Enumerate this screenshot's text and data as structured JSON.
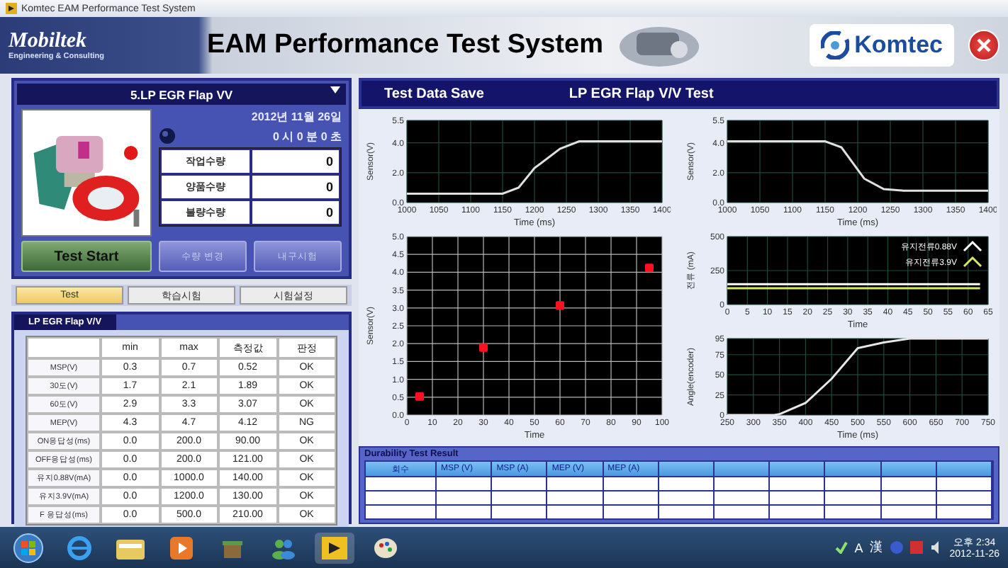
{
  "window": {
    "title": "Komtec EAM Performance Test System"
  },
  "header": {
    "logo": "Mobiltek",
    "logo_tagline": "Engineering & Consulting",
    "title": "EAM Performance Test System",
    "brand": "Komtec"
  },
  "model_select": {
    "value": "5.LP EGR Flap VV"
  },
  "date": "2012년 11월 26일",
  "time": "0 시 0 분 0 초",
  "counts": [
    {
      "label": "작업수량",
      "value": "0"
    },
    {
      "label": "양품수량",
      "value": "0"
    },
    {
      "label": "불량수량",
      "value": "0"
    }
  ],
  "buttons": [
    {
      "label": "Test Start",
      "kind": "start",
      "disabled": false
    },
    {
      "label": "수량 변경",
      "kind": "minor",
      "disabled": true
    },
    {
      "label": "내구시험",
      "kind": "minor",
      "disabled": true
    }
  ],
  "tabs": [
    {
      "label": "Test",
      "selected": true
    },
    {
      "label": "학습시험",
      "selected": false
    },
    {
      "label": "시험설정",
      "selected": false
    }
  ],
  "spec_table": {
    "title": "LP EGR Flap V/V",
    "columns": [
      "min",
      "max",
      "측정값",
      "판정"
    ],
    "rows": [
      {
        "name": "MSP(V)",
        "cells": [
          "0.3",
          "0.7",
          "0.52",
          "OK"
        ]
      },
      {
        "name": "30도(V)",
        "cells": [
          "1.7",
          "2.1",
          "1.89",
          "OK"
        ]
      },
      {
        "name": "60도(V)",
        "cells": [
          "2.9",
          "3.3",
          "3.07",
          "OK"
        ]
      },
      {
        "name": "MEP(V)",
        "cells": [
          "4.3",
          "4.7",
          "4.12",
          "NG"
        ]
      },
      {
        "name": "ON응답성(ms)",
        "cells": [
          "0.0",
          "200.0",
          "90.00",
          "OK"
        ]
      },
      {
        "name": "OFF응답성(ms)",
        "cells": [
          "0.0",
          "200.0",
          "121.00",
          "OK"
        ]
      },
      {
        "name": "유지0.88V(mA)",
        "cells": [
          "0.0",
          "1000.0",
          "140.00",
          "OK"
        ]
      },
      {
        "name": "유지3.9V(mA)",
        "cells": [
          "0.0",
          "1200.0",
          "130.00",
          "OK"
        ]
      },
      {
        "name": "F 응답성(ms)",
        "cells": [
          "0.0",
          "500.0",
          "210.00",
          "OK"
        ]
      }
    ]
  },
  "test_panel": {
    "save_button": "Test Data Save",
    "title": "LP EGR Flap V/V Test",
    "charts": [
      {
        "chart_data": {
          "type": "line",
          "xlabel": "Time (ms)",
          "ylabel": "Sensor(V)",
          "x": [
            1000,
            1150,
            1175,
            1200,
            1240,
            1270,
            1400
          ],
          "series": [
            {
              "color": "#e0e0e0",
              "values": [
                0.6,
                0.6,
                1.0,
                2.3,
                3.6,
                4.1,
                4.1
              ]
            }
          ],
          "grid": true,
          "xlim": [
            1000,
            1400
          ],
          "ylim": [
            0,
            5.5
          ],
          "xticks": [
            1000,
            1050,
            1100,
            1150,
            1200,
            1250,
            1300,
            1350,
            1400
          ],
          "yticks": [
            {
              "value": 0,
              "label": "0.0"
            },
            {
              "value": 2,
              "label": "2.0"
            },
            {
              "value": 4,
              "label": "4.0"
            },
            {
              "value": 5.5,
              "label": "5.5"
            }
          ]
        }
      },
      {
        "chart_data": {
          "type": "line",
          "xlabel": "Time (ms)",
          "ylabel": "Sensor(V)",
          "x": [
            1000,
            1150,
            1175,
            1210,
            1240,
            1270,
            1400
          ],
          "series": [
            {
              "color": "#e0e0e0",
              "values": [
                4.1,
                4.1,
                3.7,
                1.6,
                0.9,
                0.8,
                0.8
              ]
            }
          ],
          "grid": true,
          "xlim": [
            1000,
            1400
          ],
          "ylim": [
            0,
            5.5
          ],
          "xticks": [
            1000,
            1050,
            1100,
            1150,
            1200,
            1250,
            1300,
            1350,
            1400
          ],
          "yticks": [
            {
              "value": 0,
              "label": "0.0"
            },
            {
              "value": 2,
              "label": "2.0"
            },
            {
              "value": 4,
              "label": "4.0"
            },
            {
              "value": 5.5,
              "label": "5.5"
            }
          ]
        }
      },
      {
        "chart_data": {
          "type": "scatter",
          "xlabel": "Time",
          "ylabel": "Sensor(V)",
          "x": [
            5,
            30,
            60,
            95
          ],
          "series": [
            {
              "color": "#ff1020",
              "values": [
                0.52,
                1.89,
                3.07,
                4.12
              ]
            }
          ],
          "grid": true,
          "xlim": [
            0,
            100
          ],
          "ylim": [
            0,
            5
          ],
          "xticks": [
            {
              "value": 0,
              "label": "0"
            },
            10,
            20,
            30,
            40,
            50,
            60,
            70,
            80,
            90,
            100
          ],
          "yticks": [
            {
              "value": 0,
              "label": "0.0"
            },
            {
              "value": 0.5,
              "label": "0.5"
            },
            {
              "value": 1,
              "label": "1.0"
            },
            {
              "value": 1.5,
              "label": "1.5"
            },
            {
              "value": 2,
              "label": "2.0"
            },
            {
              "value": 2.5,
              "label": "2.5"
            },
            {
              "value": 3,
              "label": "3.0"
            },
            {
              "value": 3.5,
              "label": "3.5"
            },
            {
              "value": 4,
              "label": "4.0"
            },
            {
              "value": 4.5,
              "label": "4.5"
            },
            {
              "value": 5,
              "label": "5.0"
            }
          ]
        }
      },
      {
        "chart_data": {
          "type": "line",
          "xlabel": "Time",
          "ylabel": "전류 (mA)",
          "x": [
            0,
            63
          ],
          "series": [
            {
              "name": "유지전류0.88V",
              "color": "#ffffff",
              "values": [
                150,
                150
              ]
            },
            {
              "name": "유지전류3.9V",
              "color": "#d8e860",
              "values": [
                120,
                120
              ]
            }
          ],
          "grid": true,
          "legend": true,
          "xlim": [
            0,
            65
          ],
          "ylim": [
            0,
            500
          ],
          "xticks": [
            {
              "value": 0,
              "label": "0"
            },
            5,
            10,
            15,
            20,
            25,
            30,
            35,
            40,
            45,
            50,
            55,
            60,
            65
          ],
          "yticks": [
            {
              "value": 0,
              "label": "0"
            },
            250,
            500
          ]
        }
      },
      {
        "chart_data": {
          "type": "line",
          "xlabel": "Time (ms)",
          "ylabel": "Angle(encoder)",
          "x": [
            250,
            340,
            350,
            400,
            450,
            500,
            550,
            600,
            750
          ],
          "series": [
            {
              "color": "#e8e8e8",
              "values": [
                0,
                0,
                1,
                15,
                45,
                83,
                90,
                95,
                95
              ]
            }
          ],
          "grid": true,
          "xlim": [
            250,
            750
          ],
          "ylim": [
            0,
            95
          ],
          "xticks": [
            250,
            300,
            350,
            400,
            450,
            500,
            550,
            600,
            650,
            700,
            750
          ],
          "yticks": [
            {
              "value": 0,
              "label": "0"
            },
            25,
            50,
            75,
            95
          ]
        }
      }
    ]
  },
  "durability": {
    "title": "Durability Test Result",
    "columns": [
      "회수",
      "MSP (V)",
      "MSP (A)",
      "MEP (V)",
      "MEP (A)"
    ]
  },
  "taskbar": {
    "tray": [
      "A",
      "漢"
    ],
    "clock_time": "오후 2:34",
    "clock_date": "2012-11-26"
  }
}
